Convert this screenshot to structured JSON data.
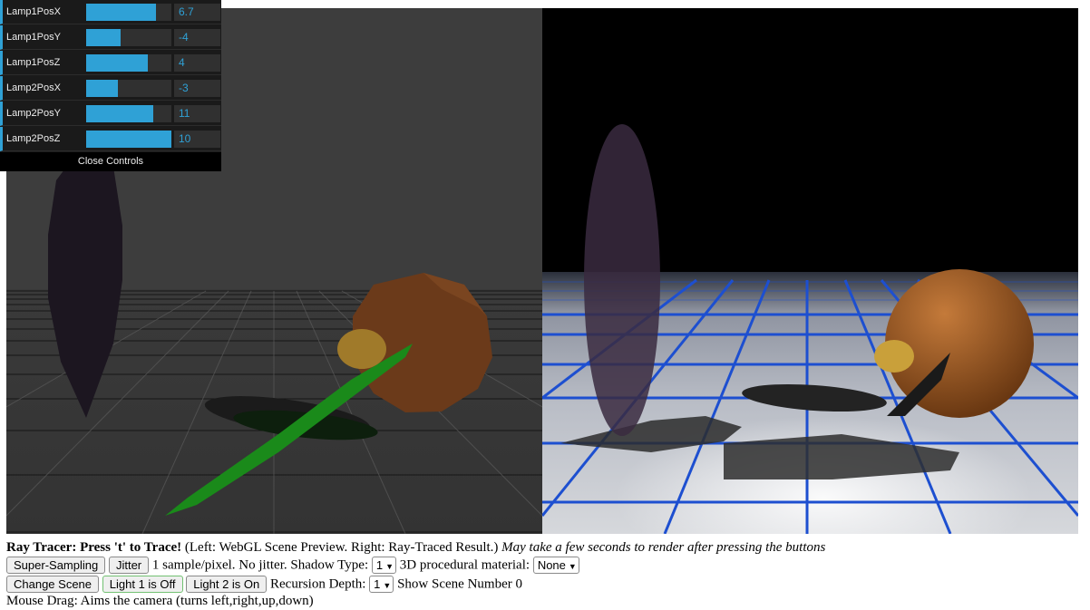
{
  "gui": {
    "controls": [
      {
        "label": "Lamp1PosX",
        "value": "6.7",
        "fraction": 0.82
      },
      {
        "label": "Lamp1PosY",
        "value": "-4",
        "fraction": 0.4
      },
      {
        "label": "Lamp1PosZ",
        "value": "4",
        "fraction": 0.72
      },
      {
        "label": "Lamp2PosX",
        "value": "-3",
        "fraction": 0.37
      },
      {
        "label": "Lamp2PosY",
        "value": "11",
        "fraction": 0.79
      },
      {
        "label": "Lamp2PosZ",
        "value": "10",
        "fraction": 1.0
      }
    ],
    "close_label": "Close Controls",
    "accent": "#2fa1d6"
  },
  "header": {
    "title": "Ray Tracer: Press 't' to Trace!",
    "description": "(Left: WebGL Scene Preview. Right: Ray-Traced Result.)",
    "note": "May take a few seconds to render after pressing the buttons"
  },
  "row1": {
    "supersampling_label": "Super-Sampling",
    "jitter_label": "Jitter",
    "status_text": "1 sample/pixel. No jitter. Shadow Type:",
    "shadow_type_value": "1",
    "material_text": "3D procedural material:",
    "material_value": "None"
  },
  "row2": {
    "change_scene_label": "Change Scene",
    "light1_label": "Light 1 is Off",
    "light2_label": "Light 2 is On",
    "recursion_text": "Recursion Depth:",
    "recursion_value": "1",
    "scene_text": "Show Scene Number 0"
  },
  "row3": {
    "hint": "Mouse Drag: Aims the camera (turns left,right,up,down)"
  },
  "icons": {
    "dropdown": "chevron-down-icon"
  }
}
